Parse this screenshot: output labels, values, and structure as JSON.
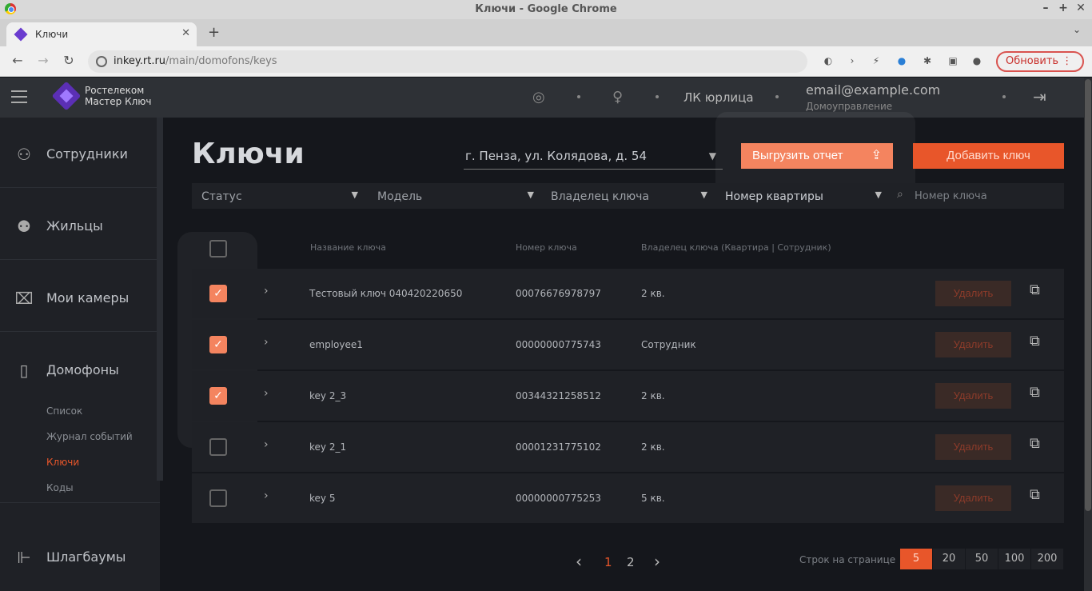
{
  "window": {
    "title": "Ключи - Google Chrome"
  },
  "tab": {
    "title": "Ключи"
  },
  "toolbar": {
    "url_host": "inkey.rt.ru",
    "url_path": "/main/domofons/keys",
    "update_label": "Обновить"
  },
  "header": {
    "logo_line1": "Ростелеком",
    "logo_line2": "Мастер Ключ",
    "role": "ЛК юрлица",
    "email": "email@example.com",
    "org": "Домоуправление"
  },
  "sidebar": {
    "items": [
      {
        "label": "Сотрудники",
        "icon": "user-icon"
      },
      {
        "label": "Жильцы",
        "icon": "users-icon"
      },
      {
        "label": "Мои камеры",
        "icon": "camera-icon"
      },
      {
        "label": "Домофоны",
        "icon": "intercom-icon"
      },
      {
        "label": "Шлагбаумы",
        "icon": "barrier-icon"
      }
    ],
    "sub_items": [
      {
        "label": "Список"
      },
      {
        "label": "Журнал событий"
      },
      {
        "label": "Ключи"
      },
      {
        "label": "Коды"
      }
    ]
  },
  "main": {
    "title": "Ключи",
    "address": "г. Пенза, ул. Колядова, д. 54",
    "export_label": "Выгрузить отчет",
    "add_label": "Добавить ключ",
    "filters": {
      "status": "Статус",
      "model": "Модель",
      "owner": "Владелец ключа",
      "apartment": "Номер квартиры",
      "search_placeholder": "Номер ключа"
    },
    "columns": {
      "name": "Название ключа",
      "number": "Номер ключа",
      "owner": "Владелец ключа (Квартира | Сотрудник)"
    },
    "delete_label": "Удалить",
    "rows": [
      {
        "name": "Тестовый ключ 040420220650",
        "number": "00076676978797",
        "owner": "2 кв.",
        "checked": true
      },
      {
        "name": "employee1",
        "number": "00000000775743",
        "owner": "Сотрудник",
        "checked": true
      },
      {
        "name": "key 2_3",
        "number": "00344321258512",
        "owner": "2 кв.",
        "checked": true
      },
      {
        "name": "key 2_1",
        "number": "00001231775102",
        "owner": "2 кв.",
        "checked": false
      },
      {
        "name": "key 5",
        "number": "00000000775253",
        "owner": "5 кв.",
        "checked": false
      }
    ]
  },
  "pagination": {
    "pages": [
      "1",
      "2"
    ],
    "current_page": "1",
    "rows_per_page_label": "Строк на странице",
    "rows_per_page_options": [
      "5",
      "20",
      "50",
      "100",
      "200"
    ],
    "rows_per_page_selected": "5"
  },
  "colors": {
    "accent": "#e8562a",
    "accent_light": "#f4845f",
    "background": "#15171c",
    "panel": "#1f2126"
  }
}
